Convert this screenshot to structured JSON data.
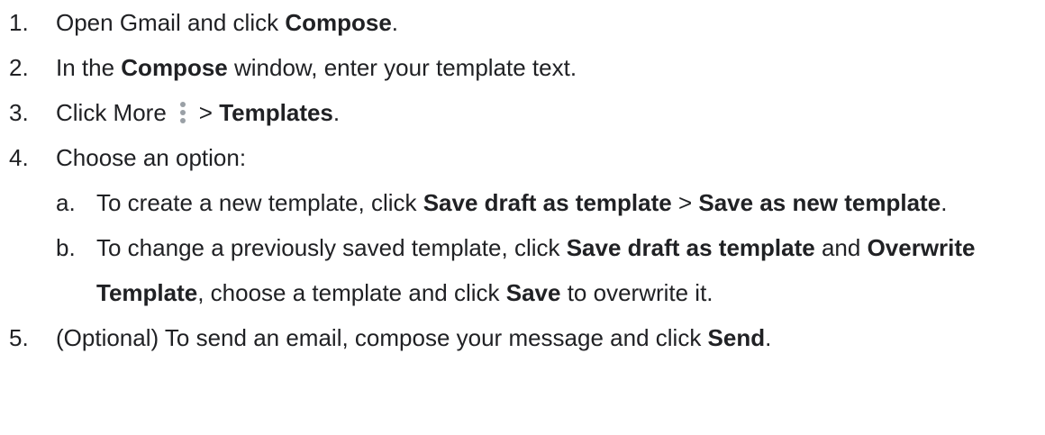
{
  "steps": {
    "s1": {
      "num": "1.",
      "text1": "Open Gmail and click ",
      "b1": "Compose",
      "text2": "."
    },
    "s2": {
      "num": "2.",
      "text1": "In the ",
      "b1": "Compose",
      "text2": " window, enter your template text."
    },
    "s3": {
      "num": "3.",
      "text1": "Click More",
      "icon": "more-vertical-icon",
      "text2": "> ",
      "b1": "Templates",
      "text3": "."
    },
    "s4": {
      "num": "4.",
      "text1": "Choose an option:",
      "a": {
        "num": "a.",
        "text1": "To create a new template, click ",
        "b1": "Save draft as template",
        "text2": " > ",
        "b2": "Save as new template",
        "text3": "."
      },
      "b": {
        "num": "b.",
        "text1": "To change a previously saved template, click ",
        "b1": "Save draft as template",
        "text2": " and ",
        "b2": "Overwrite Template",
        "text3": ", choose a template and click ",
        "b3": "Save",
        "text4": " to overwrite it."
      }
    },
    "s5": {
      "num": "5.",
      "text1": "(Optional) To send an email, compose your message and click ",
      "b1": "Send",
      "text2": "."
    }
  },
  "colors": {
    "text": "#202124",
    "icon": "#9aa0a6"
  }
}
